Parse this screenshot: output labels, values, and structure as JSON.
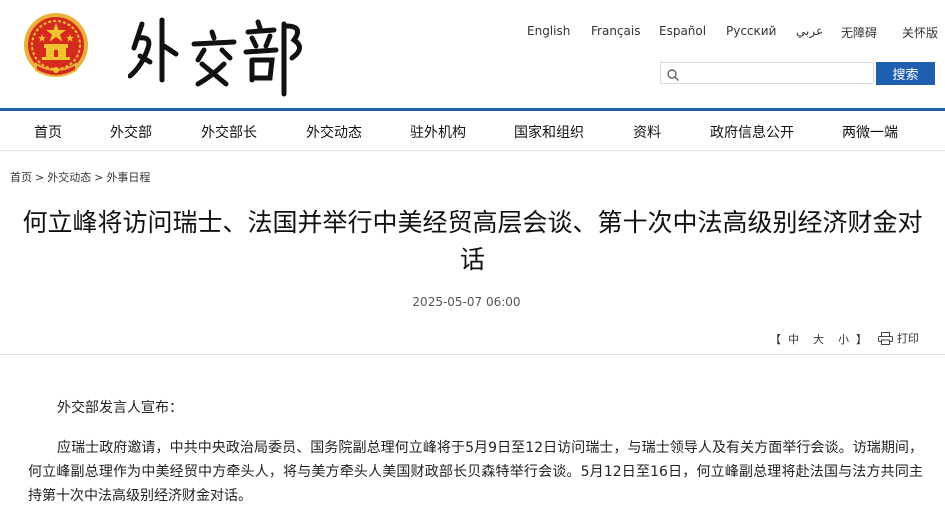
{
  "header": {
    "logo_text": "外交部",
    "languages": [
      "English",
      "Français",
      "Español",
      "Русский",
      "عربي",
      "无障碍",
      "关怀版"
    ],
    "search": {
      "placeholder": "",
      "button_label": "搜索"
    }
  },
  "nav": {
    "items": [
      "首页",
      "外交部",
      "外交部长",
      "外交动态",
      "驻外机构",
      "国家和组织",
      "资料",
      "政府信息公开",
      "两微一端"
    ]
  },
  "breadcrumb": [
    "首页",
    "外交动态",
    "外事日程"
  ],
  "article": {
    "title": "何立峰将访问瑞士、法国并举行中美经贸高层会谈、第十次中法高级别经济财金对话",
    "date": "2025-05-07 06:00",
    "font_size_label_open": "【",
    "font_sizes": [
      "中",
      "大",
      "小"
    ],
    "font_size_label_close": "】",
    "print_label": "打印",
    "paragraphs": [
      "外交部发言人宣布：",
      "应瑞士政府邀请，中共中央政治局委员、国务院副总理何立峰将于5月9日至12日访问瑞士，与瑞士领导人及有关方面举行会谈。访瑞期间，何立峰副总理作为中美经贸中方牵头人，将与美方牵头人美国财政部长贝森特举行会谈。5月12日至16日，何立峰副总理将赴法国与法方共同主持第十次中法高级别经济财金对话。"
    ]
  },
  "colors": {
    "accent_blue": "#1f5fb0",
    "emblem_red": "#d52b1e",
    "emblem_gold": "#f2c230"
  }
}
